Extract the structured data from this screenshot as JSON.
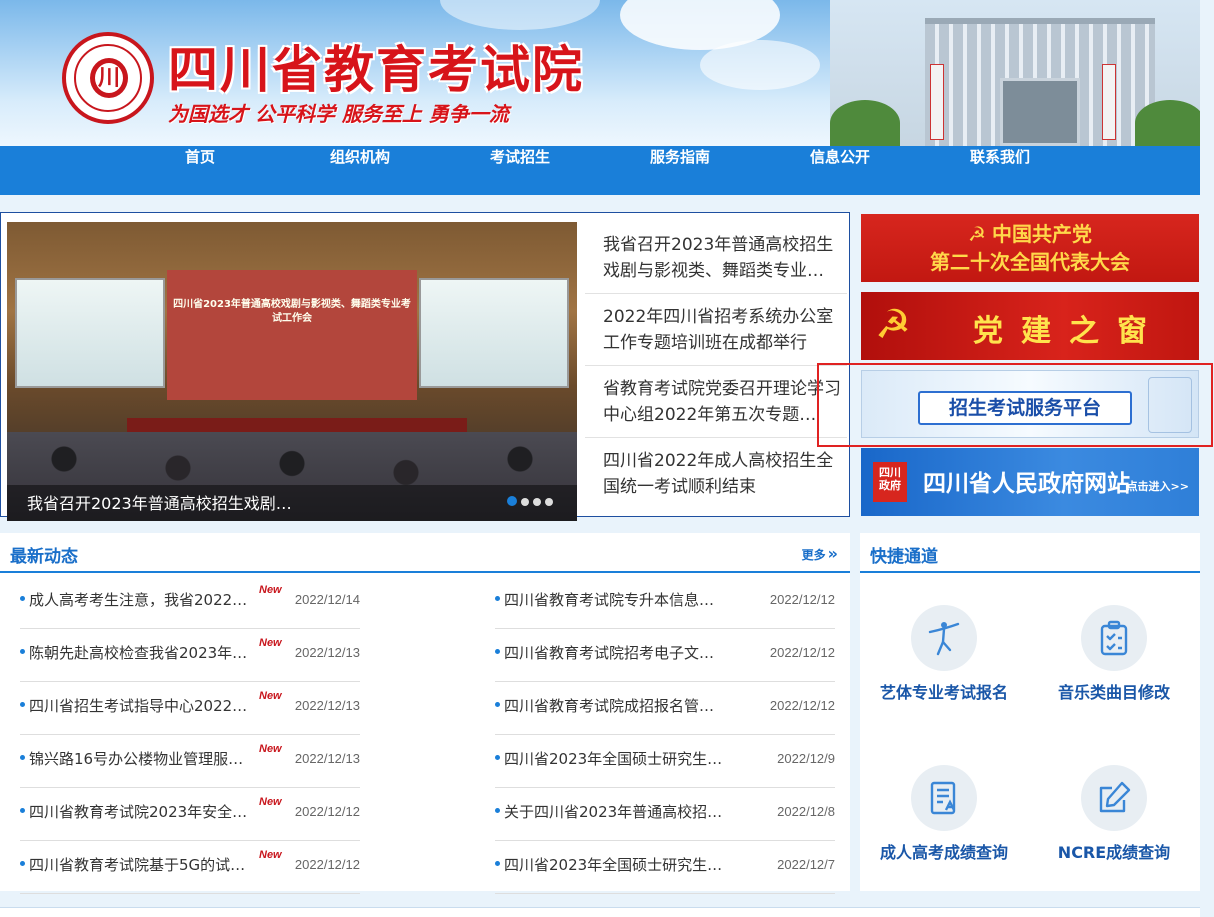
{
  "header": {
    "title": "四川省教育考试院",
    "slogan": "为国选才  公平科学  服务至上  勇争一流"
  },
  "nav": {
    "items": [
      "首页",
      "组织机构",
      "考试招生",
      "服务指南",
      "信息公开",
      "联系我们"
    ]
  },
  "carousel": {
    "caption": "我省召开2023年普通高校招生戏剧…",
    "stage_banner": "四川省2023年普通高校戏剧与影视类、舞蹈类专业考试工作会",
    "slide_count": 4,
    "active_slide": 1
  },
  "headlines": [
    "我省召开2023年普通高校招生戏剧与影视类、舞蹈类专业…",
    "2022年四川省招考系统办公室工作专题培训班在成都举行",
    "省教育考试院党委召开理论学习中心组2022年第五次专题…",
    "四川省2022年成人高校招生全国统一考试顺利结束"
  ],
  "side_banners": {
    "party_congress": "中国共产党\n第二十次全国代表大会",
    "party_window": "党建之窗",
    "platform": "招生考试服务平台",
    "gov_site": "四川省人民政府网站",
    "gov_enter": "点击进入>>"
  },
  "news": {
    "title": "最新动态",
    "more": "更多",
    "new_badge": "New",
    "left": [
      {
        "title": "成人高考考生注意，我省2022…",
        "date": "2022/12/14"
      },
      {
        "title": "陈朝先赴高校检查我省2023年…",
        "date": "2022/12/13"
      },
      {
        "title": "四川省招生考试指导中心2022…",
        "date": "2022/12/13"
      },
      {
        "title": "锦兴路16号办公楼物业管理服…",
        "date": "2022/12/13"
      },
      {
        "title": "四川省教育考试院2023年安全…",
        "date": "2022/12/12"
      },
      {
        "title": "四川省教育考试院基于5G的试…",
        "date": "2022/12/12"
      }
    ],
    "right": [
      {
        "title": "四川省教育考试院专升本信息…",
        "date": "2022/12/12"
      },
      {
        "title": "四川省教育考试院招考电子文…",
        "date": "2022/12/12"
      },
      {
        "title": "四川省教育考试院成招报名管…",
        "date": "2022/12/12"
      },
      {
        "title": "四川省2023年全国硕士研究生…",
        "date": "2022/12/9"
      },
      {
        "title": "关于四川省2023年普通高校招…",
        "date": "2022/12/8"
      },
      {
        "title": "四川省2023年全国硕士研究生…",
        "date": "2022/12/7"
      }
    ]
  },
  "quick": {
    "title": "快捷通道",
    "items": [
      {
        "label": "艺体专业考试报名",
        "icon": "dancer-icon"
      },
      {
        "label": "音乐类曲目修改",
        "icon": "clipboard-check-icon"
      },
      {
        "label": "成人高考成绩查询",
        "icon": "document-score-icon"
      },
      {
        "label": "NCRE成绩查询",
        "icon": "edit-icon"
      }
    ]
  },
  "colors": {
    "brand_red": "#d7141a",
    "nav_blue": "#1a7fd9",
    "link_blue": "#1a6fc9",
    "highlight_red": "#e02222"
  }
}
